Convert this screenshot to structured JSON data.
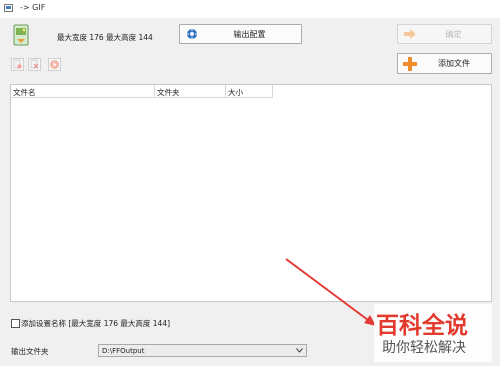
{
  "window": {
    "title": "-> GIF"
  },
  "header": {
    "max_width_label": "最大宽度",
    "max_width_value": "176",
    "max_height_label": "最大高度",
    "max_height_value": "144"
  },
  "buttons": {
    "output_config": "输出配置",
    "ok": "确定",
    "add_file": "添加文件"
  },
  "file_list": {
    "columns": [
      "文件名",
      "文件夹",
      "大小"
    ],
    "rows": []
  },
  "options": {
    "add_setting_name_label": "添加设置名称 [最大宽度 176 最大高度 144]",
    "add_setting_name_checked": false
  },
  "output": {
    "folder_label": "输出文件夹",
    "folder_value": "D:\\FFOutput"
  },
  "watermark": {
    "line1": "百科全说",
    "line2": "助你轻松解决"
  },
  "colors": {
    "window_bg": "#f0f0f0",
    "accent_orange": "#f08c2c",
    "annotation_arrow": "#e53935",
    "watermark_red": "#e23b2e"
  }
}
